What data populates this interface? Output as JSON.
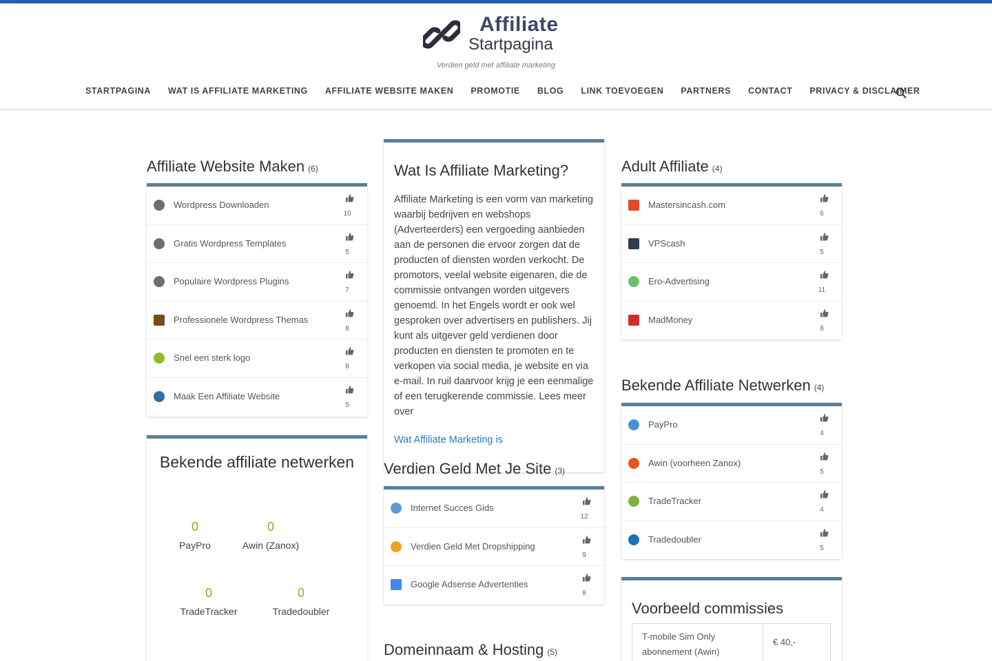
{
  "site": {
    "logo_line1": "Affiliate",
    "logo_line2": "Startpagina",
    "tagline": "Verdien geld met affiliate marketing"
  },
  "nav": {
    "items": [
      {
        "label": "STARTPAGINA"
      },
      {
        "label": "WAT IS AFFILIATE MARKETING"
      },
      {
        "label": "AFFILIATE WEBSITE MAKEN"
      },
      {
        "label": "PROMOTIE"
      },
      {
        "label": "BLOG"
      },
      {
        "label": "LINK TOEVOEGEN"
      },
      {
        "label": "PARTNERS"
      },
      {
        "label": "CONTACT"
      },
      {
        "label": "PRIVACY & DISCLAIMER"
      }
    ],
    "search_icon": "search-icon"
  },
  "affiliate_website_maken": {
    "title": "Affiliate Website Maken",
    "count": "(6)",
    "items": [
      {
        "label": "Wordpress Downloaden",
        "votes": "10",
        "icon": "wordpress-icon",
        "color": "#6d6d6d"
      },
      {
        "label": "Gratis Wordpress Templates",
        "votes": "5",
        "icon": "wordpress-icon",
        "color": "#6d6d6d"
      },
      {
        "label": "Populaire Wordpress Plugins",
        "votes": "7",
        "icon": "wordpress-icon",
        "color": "#6d6d6d"
      },
      {
        "label": "Professionele Wordpress Themas",
        "votes": "8",
        "icon": "themes-icon",
        "color": "#7a4a1c"
      },
      {
        "label": "Snel een sterk logo",
        "votes": "8",
        "icon": "logo-q-icon",
        "color": "#8dbb2a"
      },
      {
        "label": "Maak Een Affiliate Website",
        "votes": "5",
        "icon": "chain-link-icon",
        "color": "#2f6fa6"
      }
    ]
  },
  "bekende_netwerken_widget": {
    "title": "Bekende affiliate netwerken",
    "items": [
      {
        "value": "0",
        "label": "PayPro"
      },
      {
        "value": "0",
        "label": "Awin (Zanox)"
      },
      {
        "value": "0",
        "label": "TradeTracker"
      },
      {
        "value": "0",
        "label": "Tradedoubler"
      }
    ]
  },
  "wat_is": {
    "title": "Wat Is Affiliate Marketing?",
    "text": "Affiliate Marketing is een vorm van marketing waarbij bedrijven en webshops (Adverteerders) een vergoeding aanbieden aan de personen die ervoor zorgen dat de producten of diensten worden verkocht. De promotors, veelal website eigenaren, die de commissie ontvangen worden uitgevers genoemd. In het Engels wordt er ook wel gesproken over advertisers en publishers. Jij kunt als uitgever geld verdienen door producten en diensten te promoten en te verkopen via social media, je website en via e-mail. In ruil daarvoor krijg je een eenmalige of een terugkerende commissie. Lees meer over",
    "link": "Wat Affiliate Marketing is"
  },
  "verdien_geld": {
    "title": "Verdien Geld Met Je Site",
    "count": "(3)",
    "items": [
      {
        "label": "Internet Succes Gids",
        "votes": "12",
        "icon": "book-icon",
        "color": "#5a9bd5"
      },
      {
        "label": "Verdien Geld Met Dropshipping",
        "votes": "9",
        "icon": "dropshipping-icon",
        "color": "#f0a020"
      },
      {
        "label": "Google Adsense Advertenties",
        "votes": "8",
        "icon": "adsense-icon",
        "color": "#4285f4"
      }
    ]
  },
  "domeinnaam": {
    "title": "Domeinnaam & Hosting",
    "count": "(5)"
  },
  "adult_affiliate": {
    "title": "Adult Affiliate",
    "count": "(4)",
    "items": [
      {
        "label": "Mastersincash.com",
        "votes": "6",
        "icon": "m-logo-icon",
        "color": "#e2492b"
      },
      {
        "label": "VPScash",
        "votes": "5",
        "icon": "v-logo-icon",
        "color": "#2c3e50"
      },
      {
        "label": "Ero-Advertising",
        "votes": "11",
        "icon": "ero-icon",
        "color": "#6cbf6c"
      },
      {
        "label": "MadMoney",
        "votes": "8",
        "icon": "madmoney-icon",
        "color": "#d62b2b"
      }
    ]
  },
  "bekende_netwerken_list": {
    "title": "Bekende Affiliate Netwerken",
    "count": "(4)",
    "items": [
      {
        "label": "PayPro",
        "votes": "4",
        "icon": "paypro-icon",
        "color": "#4a90d9"
      },
      {
        "label": "Awin (voorheen Zanox)",
        "votes": "5",
        "icon": "awin-icon",
        "color": "#e8541e"
      },
      {
        "label": "TradeTracker",
        "votes": "4",
        "icon": "tradetracker-icon",
        "color": "#7fb23a"
      },
      {
        "label": "Tradedoubler",
        "votes": "5",
        "icon": "tradedoubler-icon",
        "color": "#1d73b5"
      }
    ]
  },
  "voorbeeld": {
    "title": "Voorbeeld commissies",
    "row_label": "T-mobile Sim Only abonnement (Awin)",
    "row_value": "€ 40,-"
  },
  "colors": {
    "accent": "#1f63b0",
    "panel_border": "#5b7f99",
    "link": "#2a7bbf",
    "counter": "#9aa51a"
  }
}
